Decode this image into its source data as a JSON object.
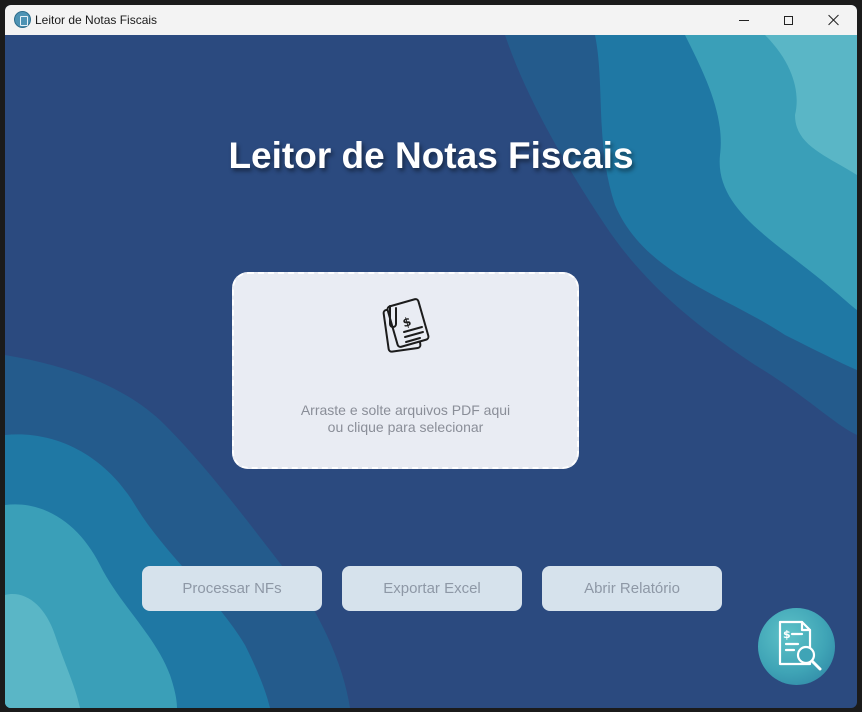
{
  "window": {
    "title": "Leitor de Notas Fiscais",
    "controls": {
      "minimize": "minimize",
      "maximize": "maximize",
      "close": "close"
    }
  },
  "main": {
    "heading": "Leitor de Notas Fiscais"
  },
  "dropzone": {
    "icon": "invoice-document-icon",
    "line1": "Arraste e solte arquivos PDF aqui",
    "line2": "ou clique para selecionar"
  },
  "actions": {
    "process_label": "Processar NFs",
    "export_label": "Exportar Excel",
    "report_label": "Abrir Relatório"
  },
  "logo": {
    "icon": "invoice-magnifier-icon"
  },
  "colors": {
    "background": "#2b4a7f",
    "wave_dark": "#245b8c",
    "wave_mid": "#1f78a4",
    "wave_light": "#3a9fb8",
    "wave_lightest": "#5ab6c6",
    "dropzone_bg": "#e9ecf3",
    "button_bg": "#d6e2ec",
    "button_text": "#8e98a6"
  }
}
